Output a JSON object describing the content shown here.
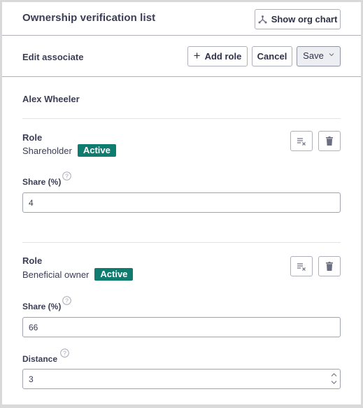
{
  "header": {
    "title": "Ownership verification list",
    "org_chart_button": "Show org chart"
  },
  "subheader": {
    "title": "Edit associate",
    "add_role_button": "Add role",
    "cancel_button": "Cancel",
    "save_button": "Save"
  },
  "associate": {
    "name": "Alex Wheeler"
  },
  "roles": [
    {
      "label": "Role",
      "value": "Shareholder",
      "status": "Active",
      "fields": [
        {
          "label": "Share (%)",
          "value": "4"
        }
      ]
    },
    {
      "label": "Role",
      "value": "Beneficial owner",
      "status": "Active",
      "fields": [
        {
          "label": "Share (%)",
          "value": "66"
        },
        {
          "label": "Distance",
          "value": "3"
        }
      ]
    }
  ],
  "colors": {
    "badge": "#107c6f",
    "text": "#3b3d56",
    "border": "#aeb1bb",
    "save_bg": "#eceef2"
  }
}
